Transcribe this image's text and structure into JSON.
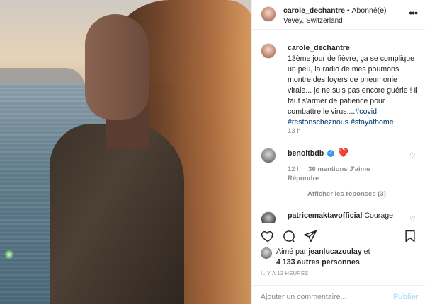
{
  "photo": {
    "icon": "portrait-photo"
  },
  "header": {
    "username": "carole_dechantre",
    "separator": "•",
    "follow_label": "Abonné(e)",
    "location": "Vevey, Switzerland",
    "more_icon": "more-horizontal-icon",
    "more_glyph": "•••"
  },
  "caption": {
    "username": "carole_dechantre",
    "text": "13ème jour de fièvre, ça se complique un peu, la radio de mes poumons montre des foyers de pneumonie virale... je ne suis pas encore guérie ! Il faut s'armer de patience pour combattre le virus....",
    "hashtags": [
      "#covid",
      "#restonscheznous",
      "#stayathome"
    ],
    "time": "13 h"
  },
  "comments": [
    {
      "username": "benoitbdb",
      "verified": true,
      "text": "❤️",
      "time": "12 h",
      "likes": "36 mentions J'aime",
      "reply_label": "Répondre",
      "view_replies": "Afficher les réponses (3)"
    },
    {
      "username": "patricemaktavofficial",
      "text": "Courage"
    }
  ],
  "actions": {
    "like_icon": "heart-icon",
    "comment_icon": "comment-icon",
    "share_icon": "share-icon",
    "save_icon": "bookmark-icon"
  },
  "likes": {
    "prefix": "Aimé par",
    "user": "jeanlucazoulay",
    "middle": "et",
    "others": "4 133 autres personnes"
  },
  "post_time": "IL Y A 13 HEURES",
  "add_comment": {
    "placeholder": "Ajouter un commentaire...",
    "post_label": "Publier"
  },
  "colors": {
    "hashtag": "#00376b",
    "verified": "#3897f0",
    "heart": "#ed4956",
    "muted": "#8e8e8e",
    "post_disabled": "#b2dffc"
  }
}
